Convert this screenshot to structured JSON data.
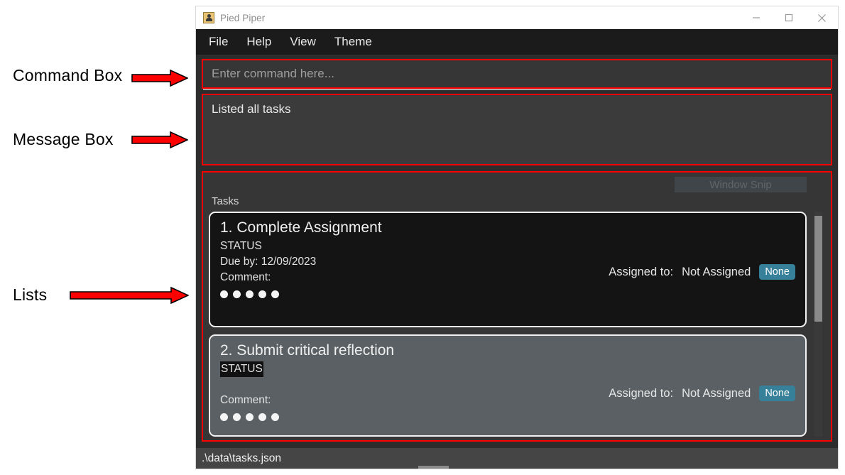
{
  "annotations": [
    {
      "label": "Command Box",
      "arrow": "right-arrow-icon"
    },
    {
      "label": "Message Box",
      "arrow": "right-arrow-icon"
    },
    {
      "label": "Lists",
      "arrow": "right-arrow-icon"
    }
  ],
  "window": {
    "title": "Pied Piper",
    "icon": "app-user-icon",
    "controls": {
      "minimize": "minimize-icon",
      "maximize": "maximize-icon",
      "close": "close-icon"
    }
  },
  "menubar": {
    "items": [
      {
        "label": "File"
      },
      {
        "label": "Help"
      },
      {
        "label": "View"
      },
      {
        "label": "Theme"
      }
    ]
  },
  "command_box": {
    "value": "",
    "placeholder": "Enter command here..."
  },
  "message_box": {
    "text": "Listed all tasks"
  },
  "lists": {
    "snip_button_label": "Window Snip",
    "section_label": "Tasks",
    "tasks": [
      {
        "title": "1. Complete Assignment",
        "status": "STATUS",
        "status_highlighted": false,
        "due": "Due by: 12/09/2023",
        "comment": "Comment:",
        "dots": 5,
        "assigned_label": "Assigned to:",
        "assigned_value": "Not Assigned",
        "assigned_badge": "None",
        "theme": "dark"
      },
      {
        "title": "2. Submit critical reflection",
        "status": "STATUS",
        "status_highlighted": true,
        "due": "",
        "comment": "Comment:",
        "dots": 5,
        "assigned_label": "Assigned to:",
        "assigned_value": "Not Assigned",
        "assigned_badge": "None",
        "theme": "gray"
      }
    ]
  },
  "statusbar": {
    "path": ".\\data\\tasks.json"
  },
  "colors": {
    "annotation_arrow": "#ff0000",
    "highlight_box": "#ff0000",
    "badge": "#37809a",
    "window_chrome": "#2d2d2d",
    "menubar": "#1b1b1b"
  }
}
